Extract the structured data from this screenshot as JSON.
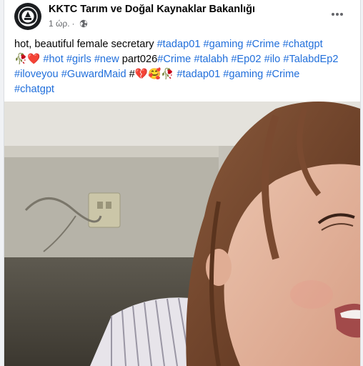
{
  "post": {
    "page_name": "KKTC Tarım ve Doğal Kaynaklar Bakanlığı",
    "timestamp": "1 ώρ.",
    "separator": "·",
    "privacy_icon": "globe-icon",
    "more_icon": "more-dots-icon",
    "text": {
      "line1_prefix": "hot, beautiful female secretary ",
      "line1_tags": [
        "#tadap01",
        "#gaming",
        "#Crime",
        "#chatgpt"
      ],
      "line2_emoji_a": "🥀",
      "line2_emoji_b": "❤️",
      "line2_tag_hot": "#hot",
      "line2_tag_girls": "#girls",
      "line2_tag_new": "#new",
      "line2_plain": "part026",
      "line2_tag_crime": "#Crime",
      "line2_tag_talabh": "#talabh",
      "line2_tag_ep02": "#Ep02",
      "line2_tag_ilo": "#ilo",
      "line2_tag_talabdep2": "#TalabdEp2",
      "line3_tag_iloveyou": "#iloveyou",
      "line3_tag_guward": "#GuwardMaid",
      "line3_hash": "#",
      "line3_emoji_broken": "💔",
      "line3_emoji_face": "🥰",
      "line3_emoji_rose": "🥀",
      "line3_tags_end": [
        "#tadap01",
        "#gaming",
        "#Crime"
      ],
      "line4_tag": "#chatgpt"
    }
  },
  "colors": {
    "link": "#216fdb",
    "text": "#050505",
    "meta": "#65676b"
  }
}
